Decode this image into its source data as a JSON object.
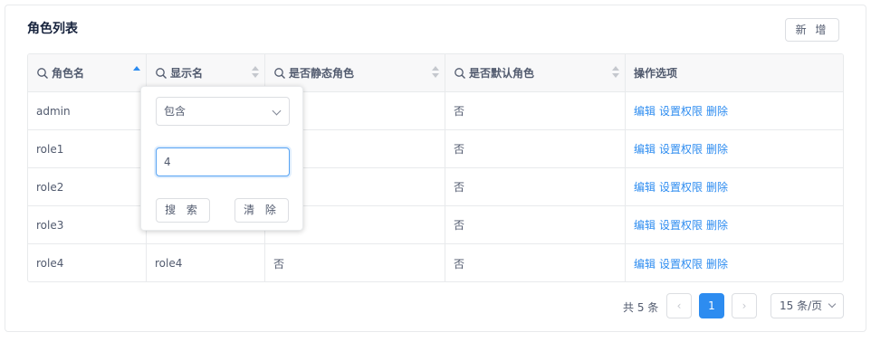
{
  "panel": {
    "title": "角色列表",
    "add_label": "新 增"
  },
  "columns": [
    {
      "label": "角色名"
    },
    {
      "label": "显示名"
    },
    {
      "label": "是否静态角色"
    },
    {
      "label": "是否默认角色"
    },
    {
      "label": "操作选项"
    }
  ],
  "rows": [
    {
      "name": "admin",
      "display": "",
      "static": "",
      "default": "否"
    },
    {
      "name": "role1",
      "display": "",
      "static": "",
      "default": "否"
    },
    {
      "name": "role2",
      "display": "",
      "static": "",
      "default": "否"
    },
    {
      "name": "role3",
      "display": "",
      "static": "",
      "default": "否"
    },
    {
      "name": "role4",
      "display": "role4",
      "static": "否",
      "default": "否"
    }
  ],
  "actions": {
    "edit": "编辑",
    "permissions": "设置权限",
    "delete": "删除"
  },
  "filter_popover": {
    "operator": "包含",
    "value": "4",
    "search_label": "搜 索",
    "clear_label": "清 除"
  },
  "pagination": {
    "total_text": "共 5 条",
    "prev": "‹",
    "current_page": "1",
    "next": "›",
    "page_size": "15 条/页"
  },
  "colors": {
    "accent": "#2d8cf0",
    "border": "#e8eaec",
    "header_bg": "#f8f8f9"
  }
}
